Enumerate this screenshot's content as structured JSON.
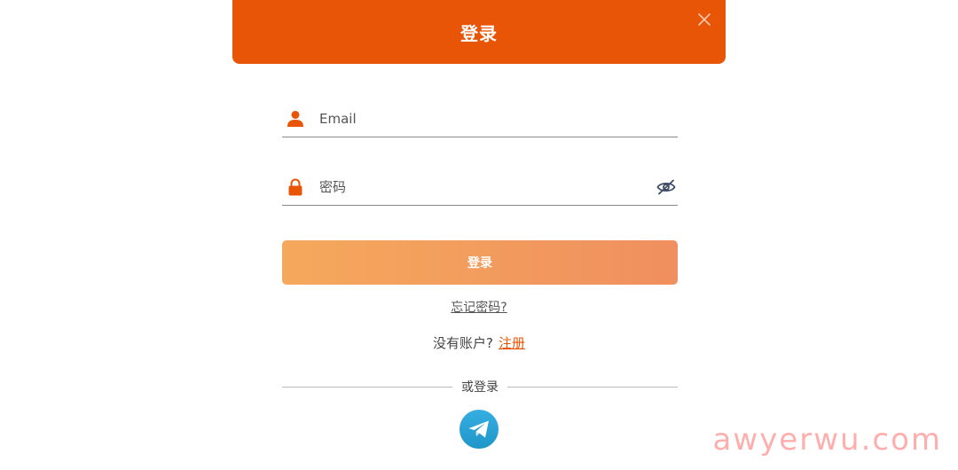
{
  "header": {
    "title": "登录"
  },
  "email": {
    "placeholder": "Email"
  },
  "password": {
    "placeholder": "密码"
  },
  "login_button": {
    "label": "登录"
  },
  "forgot": {
    "label": "忘记密码?"
  },
  "signup": {
    "prompt": "没有账户?",
    "link": "注册"
  },
  "divider": {
    "label": "或登录"
  },
  "watermark": {
    "text": "awyerwu.com"
  },
  "colors": {
    "accent": "#e95506",
    "button_start": "#f5a95c",
    "button_end": "#f08f5f",
    "telegram": "#2aa3dc"
  },
  "icons": [
    "close-icon",
    "user-icon",
    "lock-icon",
    "eye-off-icon",
    "telegram-icon"
  ]
}
